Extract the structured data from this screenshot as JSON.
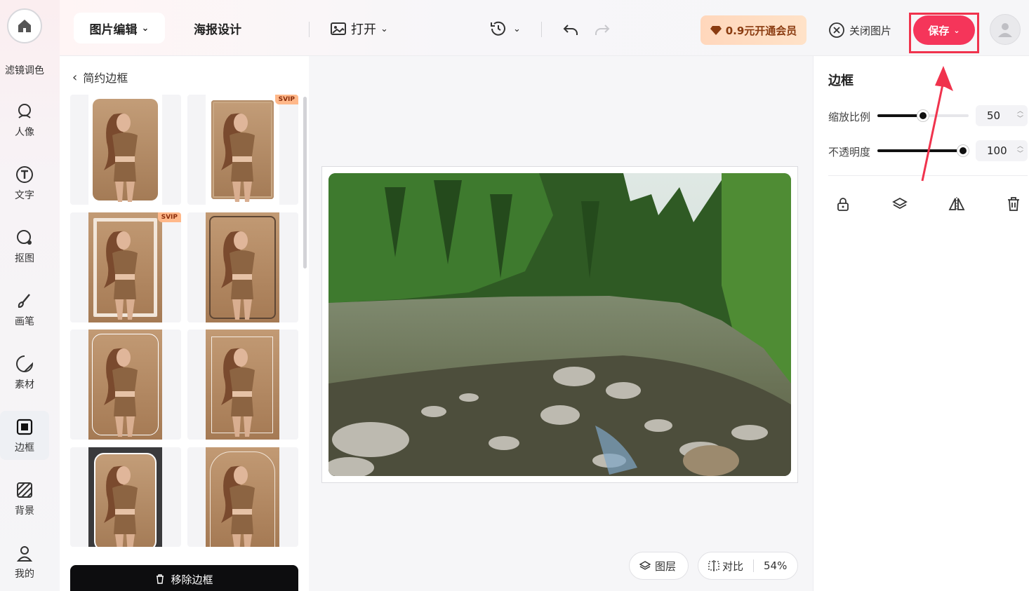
{
  "rail": {
    "cut_label": "滤镜调色",
    "items": [
      {
        "label": "人像",
        "icon": "portrait-icon"
      },
      {
        "label": "文字",
        "icon": "text-icon"
      },
      {
        "label": "抠图",
        "icon": "cutout-icon"
      },
      {
        "label": "画笔",
        "icon": "brush-icon"
      },
      {
        "label": "素材",
        "icon": "sticker-icon"
      },
      {
        "label": "边框",
        "icon": "frame-icon",
        "active": true
      },
      {
        "label": "背景",
        "icon": "background-icon"
      },
      {
        "label": "我的",
        "icon": "user-icon"
      }
    ]
  },
  "topbar": {
    "tab_active": "图片编辑",
    "tab_poster": "海报设计",
    "open_label": "打开",
    "vip_label": "0.9元开通会员",
    "close_label": "关闭图片",
    "save_label": "保存"
  },
  "left_panel": {
    "back_label": "简约边框",
    "svip_badge": "SVIP",
    "remove_label": "移除边框"
  },
  "canvas": {
    "layers_label": "图层",
    "compare_label": "对比",
    "zoom": "54%"
  },
  "right_panel": {
    "title": "边框",
    "scale_label": "缩放比例",
    "scale_value": "50",
    "opacity_label": "不透明度",
    "opacity_value": "100"
  },
  "colors": {
    "accent": "#f5355a",
    "annotation": "#f0334d",
    "vip_text": "#8a3b10"
  }
}
